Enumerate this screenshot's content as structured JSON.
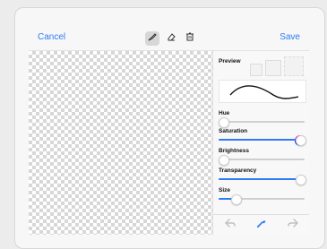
{
  "header": {
    "cancel_label": "Cancel",
    "save_label": "Save"
  },
  "tools": [
    {
      "name": "brush",
      "icon": "brush-icon",
      "active": true
    },
    {
      "name": "eraser",
      "icon": "eraser-icon",
      "active": false
    },
    {
      "name": "trash",
      "icon": "trash-icon",
      "active": false
    }
  ],
  "panel": {
    "preview_label": "Preview",
    "hue_label": "Hue",
    "saturation_label": "Saturation",
    "brightness_label": "Brightness",
    "transparency_label": "Transparency",
    "size_label": "Size",
    "hue_value": 0.0,
    "saturation_value": 1.0,
    "brightness_value": 0.0,
    "transparency_value": 0.98,
    "size_value": 0.2,
    "selected_color": "#000000"
  },
  "colors": {
    "accent": "#2f7bf6"
  },
  "bottom": {
    "undo_icon": "undo-icon",
    "eyedropper_icon": "eyedropper-icon",
    "redo_icon": "redo-icon"
  }
}
